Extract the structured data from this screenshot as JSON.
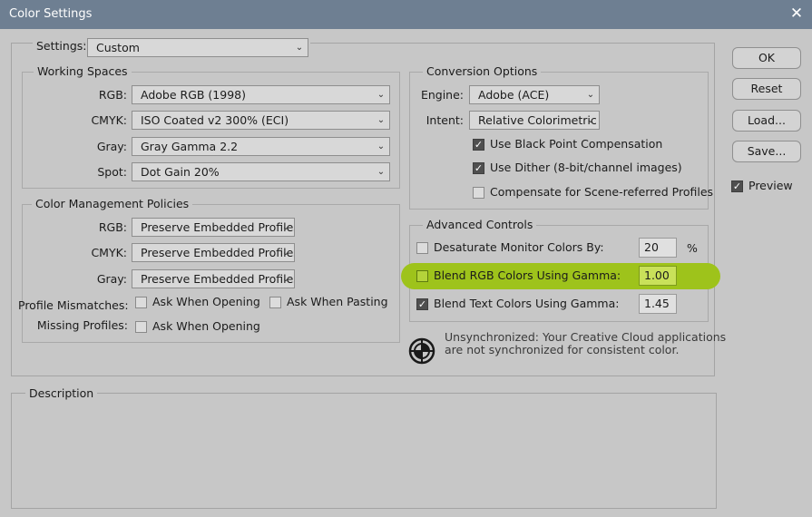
{
  "window": {
    "title": "Color Settings",
    "close_glyph": "✕"
  },
  "settings": {
    "label": "Settings:",
    "value": "Custom"
  },
  "working_spaces": {
    "title": "Working Spaces",
    "rows": [
      {
        "label": "RGB:",
        "value": "Adobe RGB (1998)"
      },
      {
        "label": "CMYK:",
        "value": "ISO Coated v2 300% (ECI)"
      },
      {
        "label": "Gray:",
        "value": "Gray Gamma 2.2"
      },
      {
        "label": "Spot:",
        "value": "Dot Gain 20%"
      }
    ]
  },
  "policies": {
    "title": "Color Management Policies",
    "rows": [
      {
        "label": "RGB:",
        "value": "Preserve Embedded Profiles"
      },
      {
        "label": "CMYK:",
        "value": "Preserve Embedded Profiles"
      },
      {
        "label": "Gray:",
        "value": "Preserve Embedded Profiles"
      }
    ],
    "mismatch_label": "Profile Mismatches:",
    "ask_opening": "Ask When Opening",
    "ask_pasting": "Ask When Pasting",
    "missing_label": "Missing Profiles:",
    "missing_ask_opening": "Ask When Opening"
  },
  "conversion": {
    "title": "Conversion Options",
    "engine_label": "Engine:",
    "engine_value": "Adobe (ACE)",
    "intent_label": "Intent:",
    "intent_value": "Relative Colorimetric",
    "black_point": "Use Black Point Compensation",
    "dither": "Use Dither (8-bit/channel images)",
    "scene": "Compensate for Scene-referred Profiles"
  },
  "advanced": {
    "title": "Advanced Controls",
    "desaturate_label": "Desaturate Monitor Colors By:",
    "desaturate_value": "20",
    "desaturate_unit": "%",
    "blend_rgb_label": "Blend RGB Colors Using Gamma:",
    "blend_rgb_value": "1.00",
    "blend_text_label": "Blend Text Colors Using Gamma:",
    "blend_text_value": "1.45"
  },
  "sync": {
    "line1": "Unsynchronized: Your Creative Cloud applications",
    "line2": "are not synchronized for consistent color.",
    "icon": "sync-status-icon"
  },
  "description": {
    "title": "Description"
  },
  "buttons": {
    "ok": "OK",
    "reset": "Reset",
    "load": "Load...",
    "save": "Save..."
  },
  "preview": {
    "label": "Preview",
    "checked": true
  },
  "colors": {
    "title_bar": "#6e7f92",
    "highlight": "#9ec31b"
  }
}
